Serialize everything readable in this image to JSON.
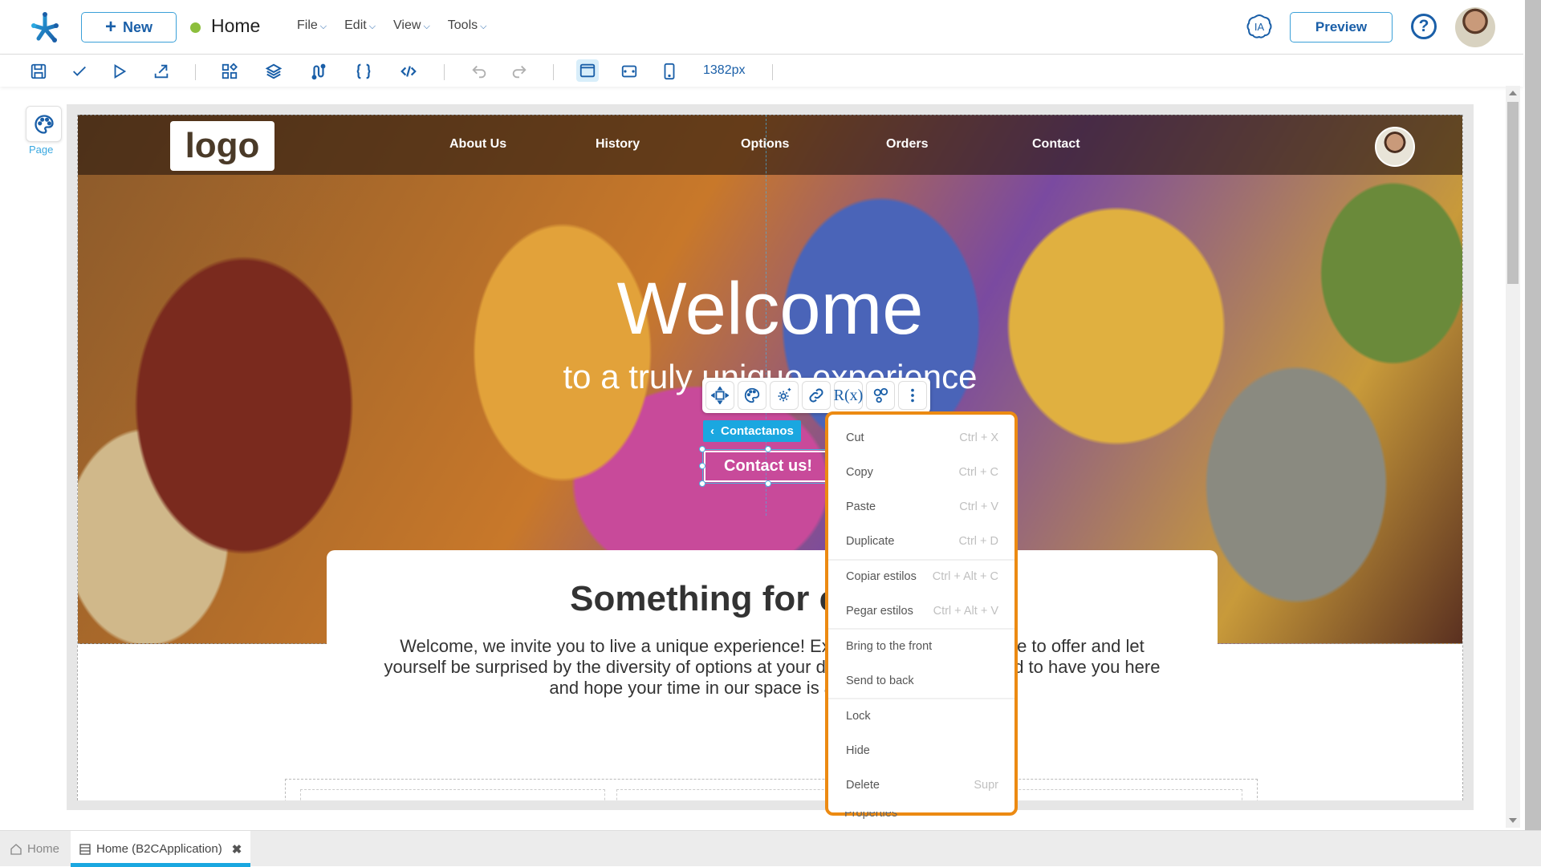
{
  "app": {
    "new_button": "New",
    "page_name": "Home",
    "status_color": "#8cbe3c",
    "menus": [
      "File",
      "Edit",
      "View",
      "Tools"
    ],
    "ia_label": "IA",
    "preview_button": "Preview",
    "help_icon": "?"
  },
  "toolbar": {
    "icons": [
      "save-icon",
      "check-icon",
      "play-icon",
      "export-icon",
      "components-icon",
      "layers-icon",
      "flow-icon",
      "braces-icon",
      "code-icon",
      "undo-icon",
      "redo-icon",
      "desktop-view-icon",
      "tablet-view-icon",
      "mobile-view-icon"
    ],
    "width_readout": "1382px"
  },
  "left_panel": {
    "page_label": "Page"
  },
  "site": {
    "logo": "logo",
    "nav": [
      "About Us",
      "History",
      "Options",
      "Orders",
      "Contact"
    ],
    "hero_title": "Welcome",
    "hero_subtitle": "to a truly unique experience",
    "cta_button": "Contact us!",
    "card_title": "Something for everyone",
    "card_text": "Welcome, we invite you to live a unique experience! Explore everything we have to offer and let yourself be surprised by the diversity of options at your disposal. We are delighted to have you here and hope your time in our space is as special as you are."
  },
  "selection": {
    "component_label": "Contactanos",
    "float_toolbar": [
      "move-icon",
      "palette-icon",
      "settings-icon",
      "link-icon",
      "R(x)",
      "connections-icon",
      "more-vertical-icon"
    ]
  },
  "context_menu": {
    "items": [
      {
        "label": "Cut",
        "shortcut": "Ctrl + X"
      },
      {
        "label": "Copy",
        "shortcut": "Ctrl + C"
      },
      {
        "label": "Paste",
        "shortcut": "Ctrl + V"
      },
      {
        "label": "Duplicate",
        "shortcut": "Ctrl + D"
      },
      {
        "label": "Copiar estilos",
        "shortcut": "Ctrl + Alt + C"
      },
      {
        "label": "Pegar estilos",
        "shortcut": "Ctrl + Alt + V"
      },
      {
        "label": "Bring to the front",
        "shortcut": ""
      },
      {
        "label": "Send to back",
        "shortcut": ""
      },
      {
        "label": "Lock",
        "shortcut": ""
      },
      {
        "label": "Hide",
        "shortcut": ""
      },
      {
        "label": "Delete",
        "shortcut": "Supr"
      }
    ],
    "overflow_item": "Properties",
    "border_color": "#ec8a12"
  },
  "bottom_tabs": {
    "home": "Home",
    "active": "Home (B2CApplication)"
  },
  "colors": {
    "primary": "#1a5fa8",
    "accent": "#1aa7e0"
  }
}
